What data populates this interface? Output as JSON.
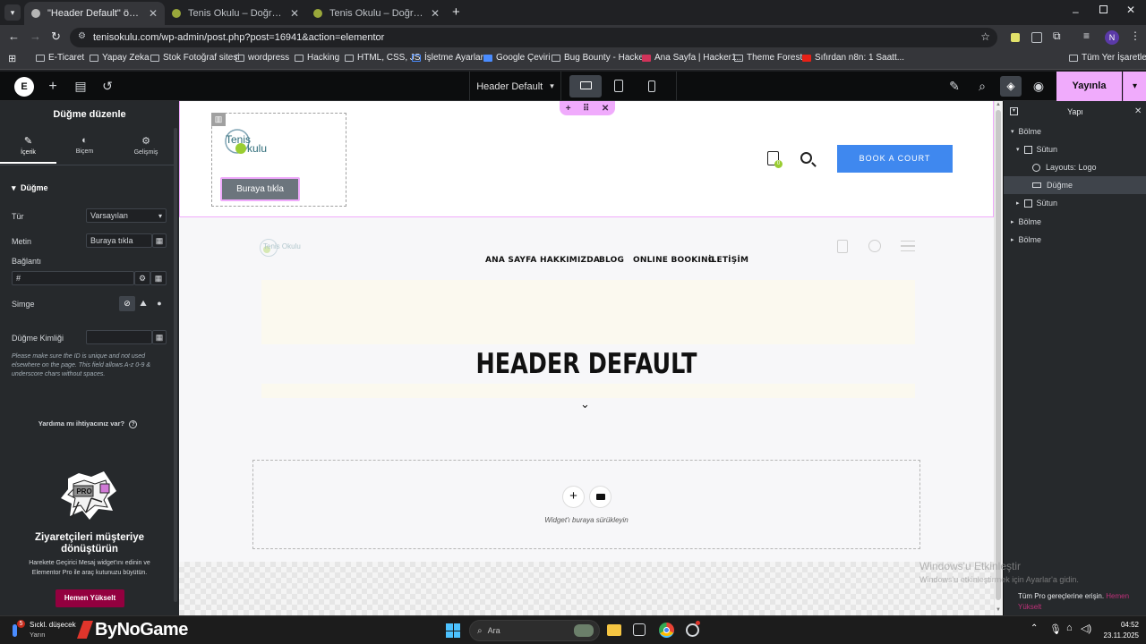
{
  "browser": {
    "tabs": [
      {
        "title": "\"Header Default\" öğesini Eleme",
        "active": true
      },
      {
        "title": "Tenis Okulu – Doğru Teknik, Gü",
        "active": false
      },
      {
        "title": "Tenis Okulu – Doğru Teknik, Gü",
        "active": false
      }
    ],
    "url": "tenisokulu.com/wp-admin/post.php?post=16941&action=elementor",
    "bookmarks": [
      "E-Ticaret",
      "Yapay Zeka",
      "Stok Fotoğraf sitesi",
      "wordpress",
      "Hacking",
      "HTML, CSS, JS",
      "İşletme Ayarları",
      "Google Çeviri",
      "Bug Bounty - Hacke...",
      "Ana Sayfa | Hacker1...",
      "Theme Forest",
      "Sıfırdan n8n: 1 Saatt..."
    ],
    "all_bookmarks": "Tüm Yer İşaretleri",
    "profile_initial": "N"
  },
  "elementor_top": {
    "document_title": "Header Default",
    "publish_label": "Yayınla"
  },
  "left_panel": {
    "title": "Düğme düzenle",
    "tabs": [
      "İçerik",
      "Biçem",
      "Gelişmiş"
    ],
    "section": "Düğme",
    "fields": {
      "type_label": "Tür",
      "type_value": "Varsayılan",
      "text_label": "Metin",
      "text_value": "Buraya tıkla",
      "link_label": "Bağlantı",
      "link_value": "#",
      "icon_label": "Simge",
      "id_label": "Düğme Kimliği",
      "help_note": "Please make sure the ID is unique and not used elsewhere on the page. This field allows A-z 0-9 & underscore chars without spaces."
    },
    "help_link": "Yardıma mı ihtiyacınız var?",
    "promo": {
      "badge": "PRO",
      "title": "Ziyaretçileri müşteriye dönüştürün",
      "text": "Harekete Geçirici Mesaj widget'ını edinin ve Elementor Pro ile araç kutunuzu büyütün.",
      "button": "Hemen Yükselt"
    }
  },
  "canvas": {
    "logo_line1": "Tenis",
    "logo_line2": "kulu",
    "button_label": "Buraya tıkla",
    "menu": [
      "ANA SAYFA",
      "HAKKIMIZDA",
      "BLOG",
      "ONLINE BOOKING",
      "İLETİŞİM"
    ],
    "cart_count": "0",
    "book_button": "BOOK A COURT",
    "ghost_logo": "Tenis Okulu",
    "hero_title": "HEADER DEFAULT",
    "drop_hint": "Widget'ı buraya sürükleyin",
    "watermark_title": "Windows'u Etkinleştir",
    "watermark_text": "Windows'u etkinleştirmek için Ayarlar'a gidin."
  },
  "navigator": {
    "title": "Yapı",
    "items": [
      {
        "label": "Bölme",
        "level": 0,
        "expanded": true
      },
      {
        "label": "Sütun",
        "level": 1,
        "expanded": true
      },
      {
        "label": "Layouts: Logo",
        "level": 2
      },
      {
        "label": "Düğme",
        "level": 2,
        "selected": true
      },
      {
        "label": "Sütun",
        "level": 1,
        "expanded": false
      },
      {
        "label": "Bölme",
        "level": 0,
        "expanded": false
      },
      {
        "label": "Bölme",
        "level": 0,
        "expanded": false
      }
    ],
    "pro_note": "Tüm Pro gereçlerine erişin.",
    "pro_link": "Hemen Yükselt"
  },
  "taskbar": {
    "weather_badge": "5",
    "weather_title": "Sıckl. düşecek",
    "weather_sub": "Yarın",
    "brand": "ByNoGame",
    "search_placeholder": "Ara",
    "time": "04:52",
    "date": "23.11.2025"
  },
  "colors": {
    "accent_pink": "#f0abfc",
    "book_blue": "#3f88ef",
    "promo_button": "#93003f",
    "dark_bg": "#26292c"
  }
}
